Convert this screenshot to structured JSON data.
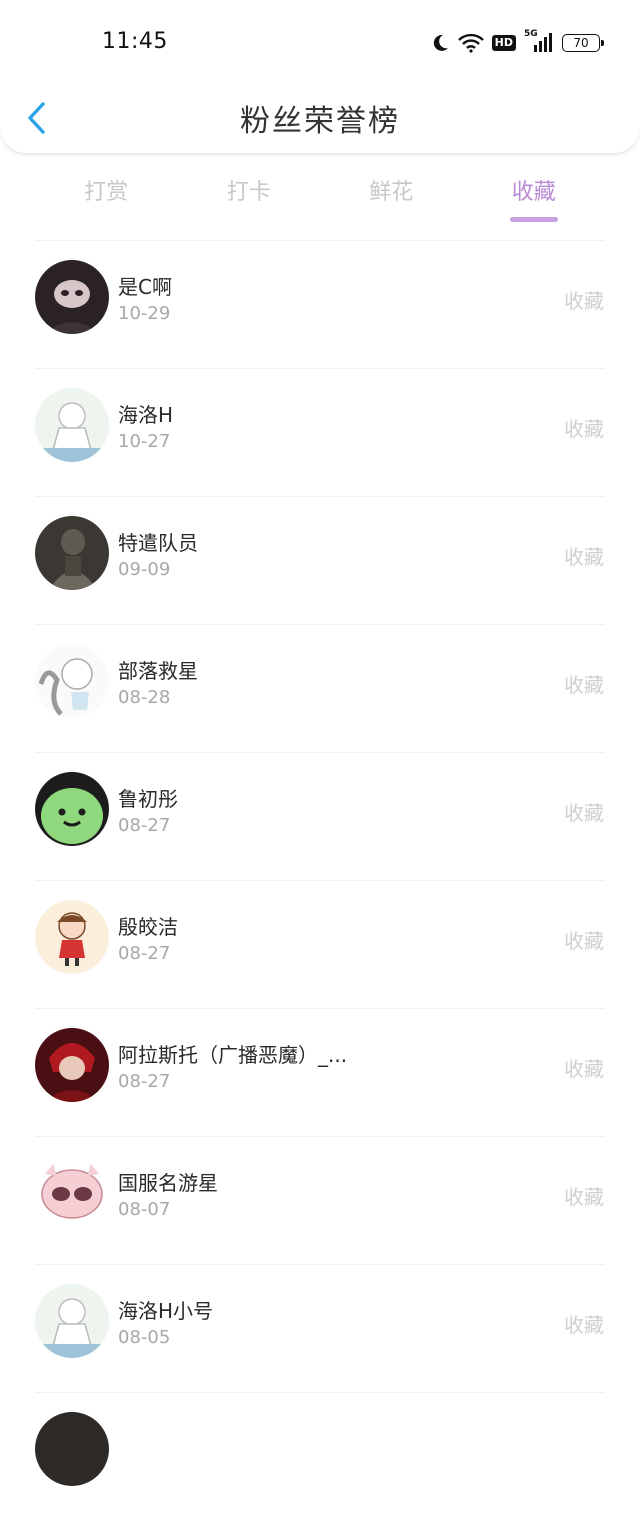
{
  "status_bar": {
    "time": "11:45",
    "network": "5G",
    "hd": "HD",
    "battery": "70",
    "icons": [
      "moon-icon",
      "wifi-icon",
      "hd-icon",
      "signal-icon",
      "battery-icon"
    ]
  },
  "header": {
    "title": "粉丝荣誉榜",
    "back_icon": "chevron-left-icon"
  },
  "tabs": [
    {
      "label": "打赏",
      "active": false
    },
    {
      "label": "打卡",
      "active": false
    },
    {
      "label": "鲜花",
      "active": false
    },
    {
      "label": "收藏",
      "active": true
    }
  ],
  "colors": {
    "accent": "#b98ad6",
    "back_arrow": "#2aa4e8",
    "inactive_tab": "#c8c8c8",
    "muted": "#a8a8a8"
  },
  "fans": [
    {
      "name": "是C啊",
      "date": "10-29",
      "action": "收藏"
    },
    {
      "name": "海洛H",
      "date": "10-27",
      "action": "收藏"
    },
    {
      "name": "特遣队员",
      "date": "09-09",
      "action": "收藏"
    },
    {
      "name": "部落救星",
      "date": "08-28",
      "action": "收藏"
    },
    {
      "name": "鲁初彤",
      "date": "08-27",
      "action": "收藏"
    },
    {
      "name": "殷皎洁",
      "date": "08-27",
      "action": "收藏"
    },
    {
      "name": "阿拉斯托（广播恶魔）_...",
      "date": "08-27",
      "action": "收藏"
    },
    {
      "name": "国服名游星",
      "date": "08-07",
      "action": "收藏"
    },
    {
      "name": "海洛H小号",
      "date": "08-05",
      "action": "收藏"
    }
  ]
}
